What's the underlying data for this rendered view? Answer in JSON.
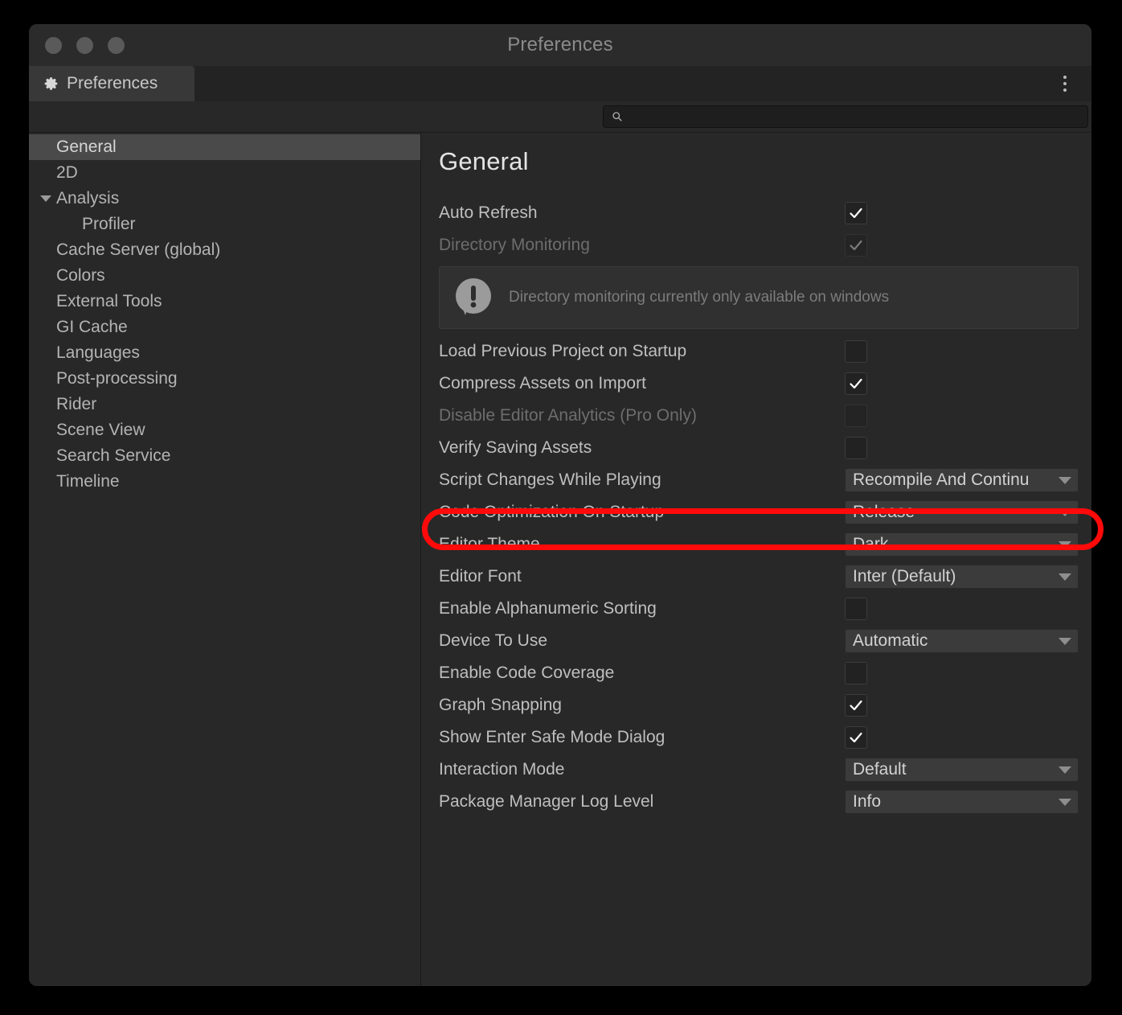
{
  "window": {
    "title": "Preferences",
    "traffic_lights": [
      "close-button",
      "minimize-button",
      "zoom-button"
    ]
  },
  "tabbar": {
    "tab_label": "Preferences",
    "tab_icon": "gear-icon",
    "overflow_icon": "kebab-menu-icon"
  },
  "search": {
    "value": "",
    "placeholder": "",
    "icon": "search-icon"
  },
  "sidebar": {
    "items": [
      {
        "label": "General",
        "selected": true,
        "child": false,
        "expander": false
      },
      {
        "label": "2D",
        "selected": false,
        "child": false,
        "expander": false
      },
      {
        "label": "Analysis",
        "selected": false,
        "child": false,
        "expander": true
      },
      {
        "label": "Profiler",
        "selected": false,
        "child": true,
        "expander": false
      },
      {
        "label": "Cache Server (global)",
        "selected": false,
        "child": false,
        "expander": false
      },
      {
        "label": "Colors",
        "selected": false,
        "child": false,
        "expander": false
      },
      {
        "label": "External Tools",
        "selected": false,
        "child": false,
        "expander": false
      },
      {
        "label": "GI Cache",
        "selected": false,
        "child": false,
        "expander": false
      },
      {
        "label": "Languages",
        "selected": false,
        "child": false,
        "expander": false
      },
      {
        "label": "Post-processing",
        "selected": false,
        "child": false,
        "expander": false
      },
      {
        "label": "Rider",
        "selected": false,
        "child": false,
        "expander": false
      },
      {
        "label": "Scene View",
        "selected": false,
        "child": false,
        "expander": false
      },
      {
        "label": "Search Service",
        "selected": false,
        "child": false,
        "expander": false
      },
      {
        "label": "Timeline",
        "selected": false,
        "child": false,
        "expander": false
      }
    ]
  },
  "content": {
    "title": "General",
    "helpbox": {
      "icon": "info-bubble-icon",
      "text": "Directory monitoring currently only available on windows"
    },
    "rows": [
      {
        "label": "Auto Refresh",
        "type": "checkbox",
        "checked": true,
        "disabled": false
      },
      {
        "label": "Directory Monitoring",
        "type": "checkbox",
        "checked": true,
        "disabled": true
      },
      {
        "label": "Load Previous Project on Startup",
        "type": "checkbox",
        "checked": false,
        "disabled": false
      },
      {
        "label": "Compress Assets on Import",
        "type": "checkbox",
        "checked": true,
        "disabled": false
      },
      {
        "label": "Disable Editor Analytics (Pro Only)",
        "type": "checkbox",
        "checked": false,
        "disabled": true
      },
      {
        "label": "Verify Saving Assets",
        "type": "checkbox",
        "checked": false,
        "disabled": false
      },
      {
        "label": "Script Changes While Playing",
        "type": "dropdown",
        "value": "Recompile And Continu",
        "disabled": false
      },
      {
        "label": "Code Optimization On Startup",
        "type": "dropdown",
        "value": "Release",
        "disabled": false
      },
      {
        "label": "Editor Theme",
        "type": "dropdown",
        "value": "Dark",
        "disabled": false,
        "annotated": true
      },
      {
        "label": "Editor Font",
        "type": "dropdown",
        "value": "Inter (Default)",
        "disabled": false
      },
      {
        "label": "Enable Alphanumeric Sorting",
        "type": "checkbox",
        "checked": false,
        "disabled": false
      },
      {
        "label": "Device To Use",
        "type": "dropdown",
        "value": "Automatic",
        "disabled": false
      },
      {
        "label": "Enable Code Coverage",
        "type": "checkbox",
        "checked": false,
        "disabled": false
      },
      {
        "label": "Graph Snapping",
        "type": "checkbox",
        "checked": true,
        "disabled": false
      },
      {
        "label": "Show Enter Safe Mode Dialog",
        "type": "checkbox",
        "checked": true,
        "disabled": false
      },
      {
        "label": "Interaction Mode",
        "type": "dropdown",
        "value": "Default",
        "disabled": false
      },
      {
        "label": "Package Manager Log Level",
        "type": "dropdown",
        "value": "Info",
        "disabled": false
      }
    ]
  },
  "annotation": {
    "color": "#ff0a0a",
    "target": "Editor Theme"
  }
}
